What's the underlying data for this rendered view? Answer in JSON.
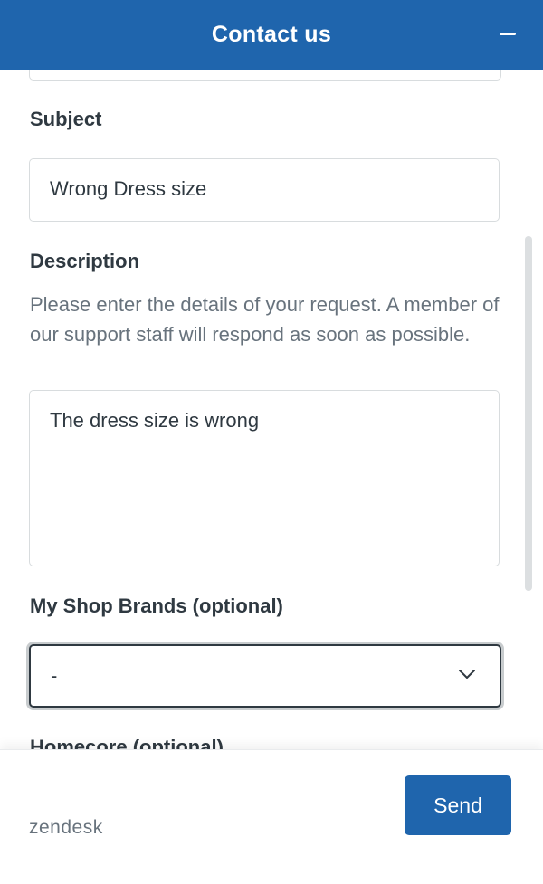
{
  "header": {
    "title": "Contact us",
    "minimize_icon": "minimize-icon",
    "background": "#1f65ad"
  },
  "form": {
    "subject": {
      "label": "Subject",
      "value": "Wrong Dress size"
    },
    "description": {
      "label": "Description",
      "help": "Please enter the details of your request. A member of our support staff will respond as soon as possible.",
      "value": "The dress size is wrong"
    },
    "brands": {
      "label": "My Shop Brands (optional)",
      "selected": "-",
      "icon": "chevron-down-icon"
    },
    "homecore": {
      "label": "Homecore (optional)"
    }
  },
  "footer": {
    "brand": "zendesk",
    "send_label": "Send",
    "accent": "#1f65ad"
  }
}
